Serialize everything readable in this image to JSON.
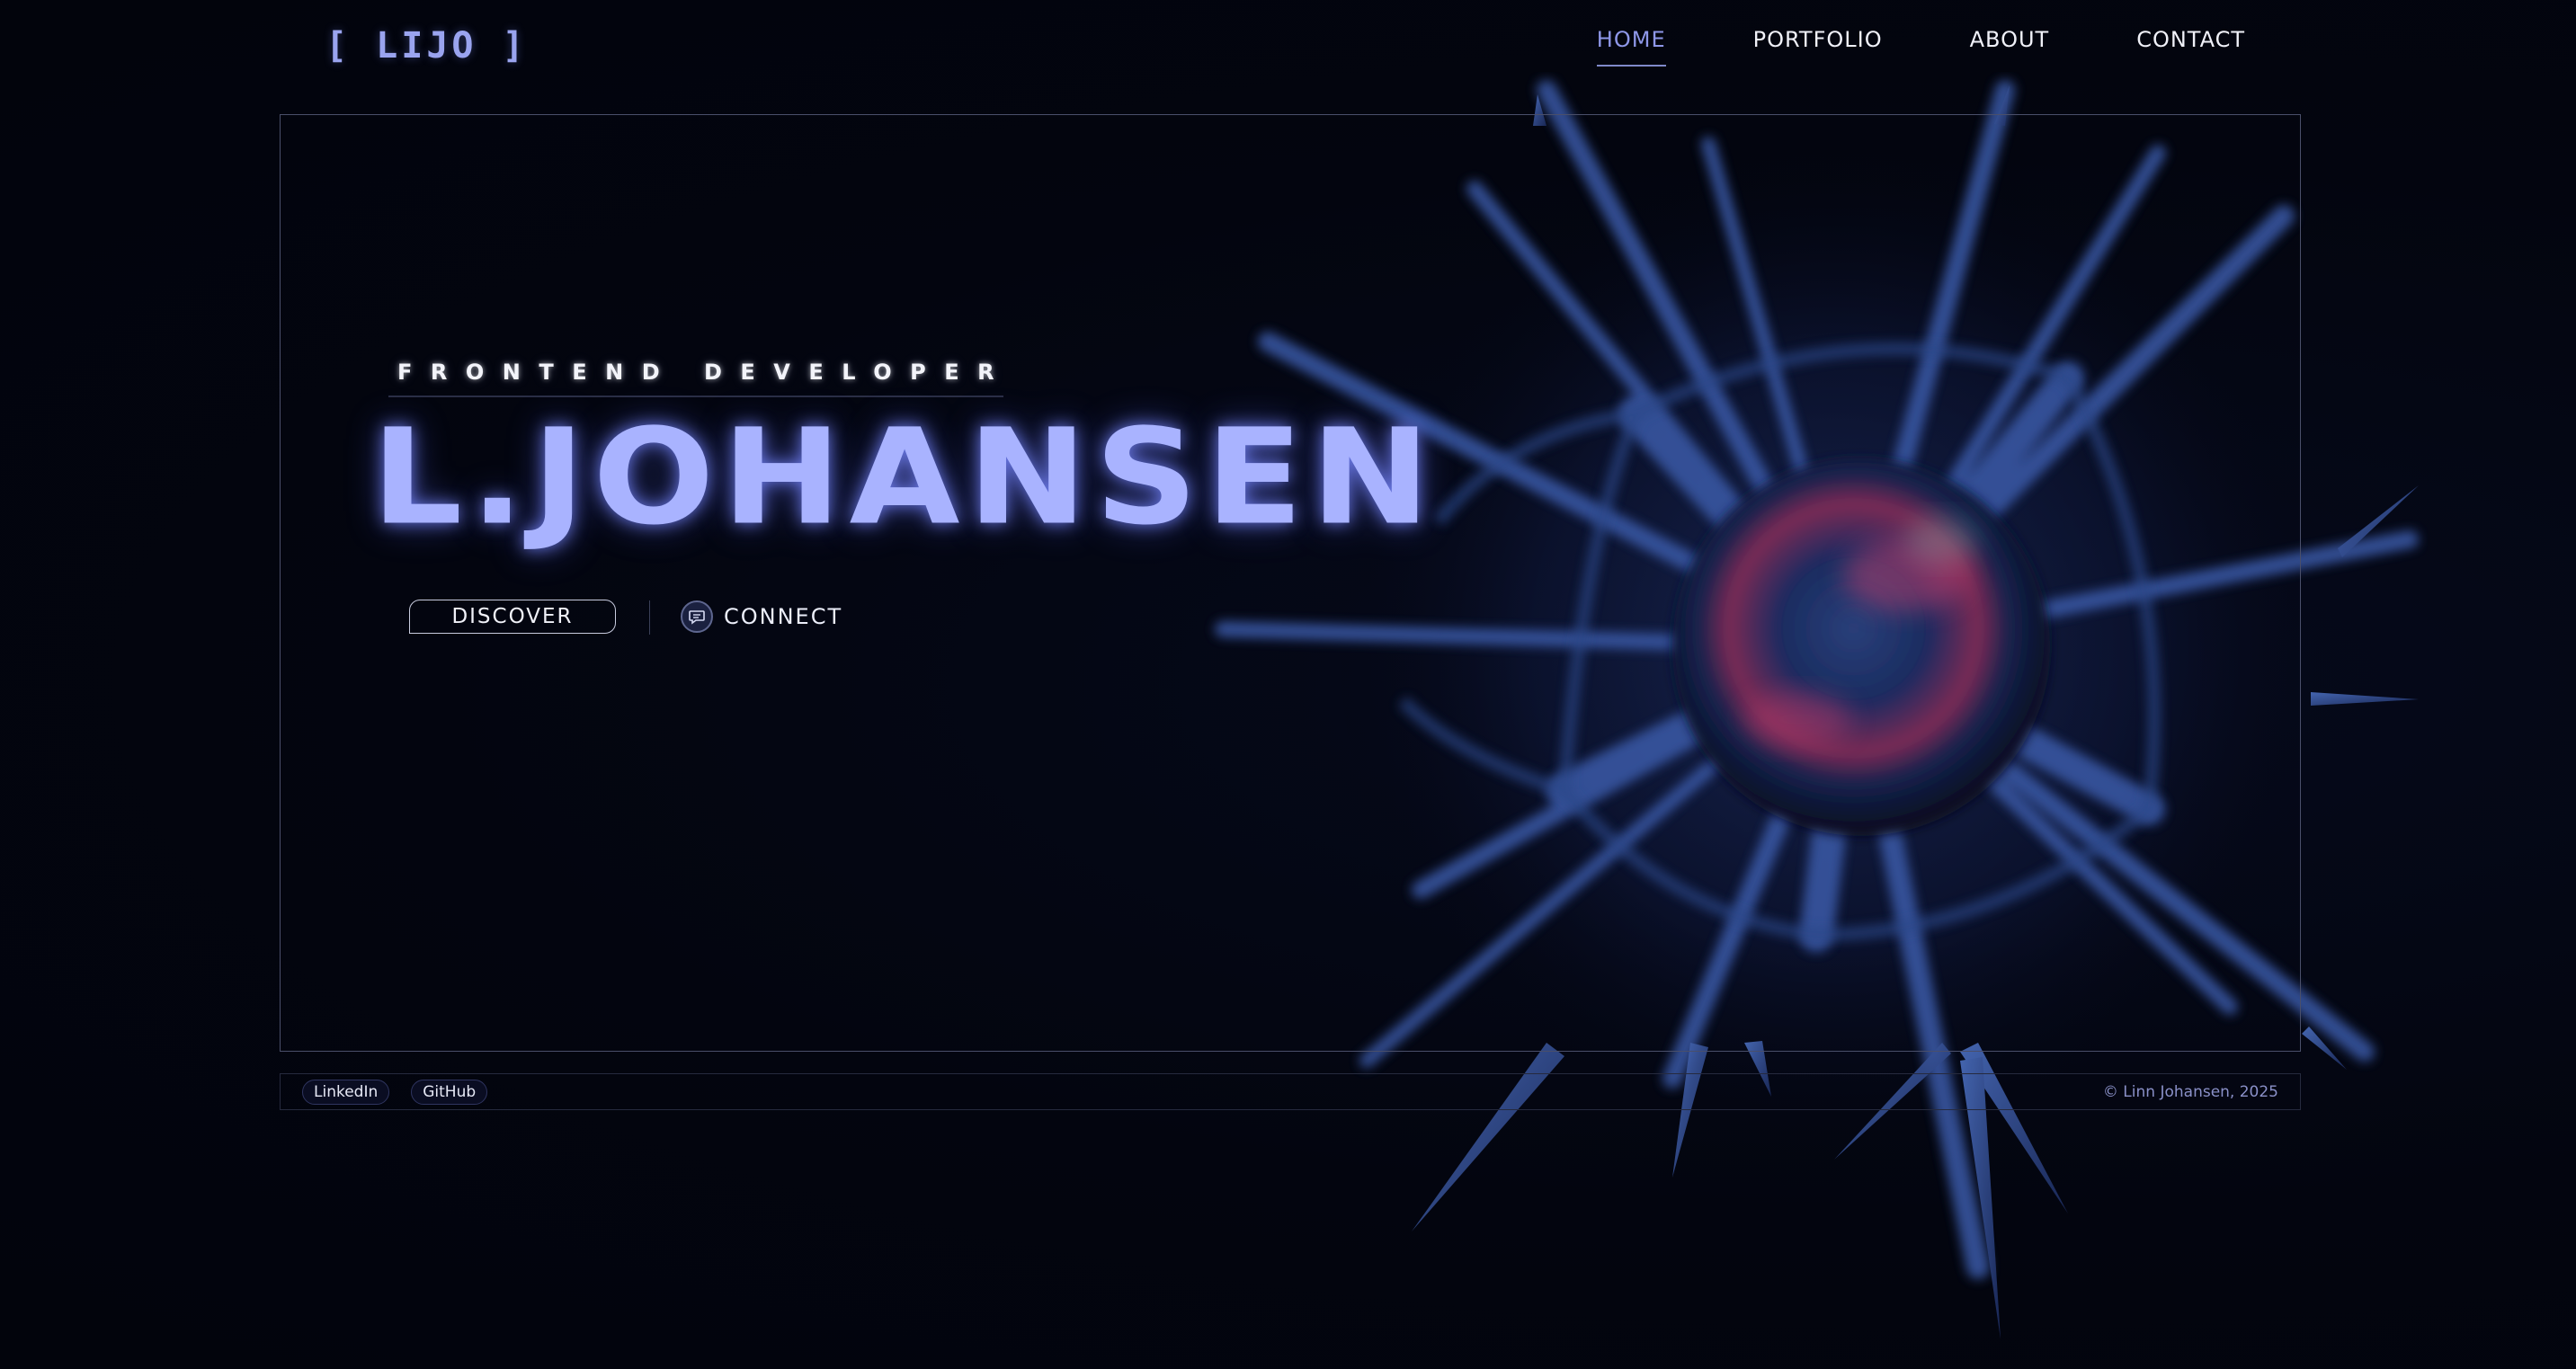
{
  "header": {
    "logo": "[ LIJO ]",
    "nav": [
      {
        "label": "HOME",
        "active": true
      },
      {
        "label": "PORTFOLIO",
        "active": false
      },
      {
        "label": "ABOUT",
        "active": false
      },
      {
        "label": "CONTACT",
        "active": false
      }
    ]
  },
  "hero": {
    "subtitle": "FRONTEND DEVELOPER",
    "name": "L.JOHANSEN",
    "discover_label": "DISCOVER",
    "connect_label": "CONNECT",
    "connect_icon": "chat-bubble-icon"
  },
  "footer": {
    "links": [
      "LinkedIn",
      "GitHub"
    ],
    "copyright": "© Linn Johansen, 2025"
  },
  "colors": {
    "background": "#03050f",
    "accent": "#a9b3ff",
    "nav_active": "#8e97e8",
    "frame_border": "#4a4f6a"
  }
}
